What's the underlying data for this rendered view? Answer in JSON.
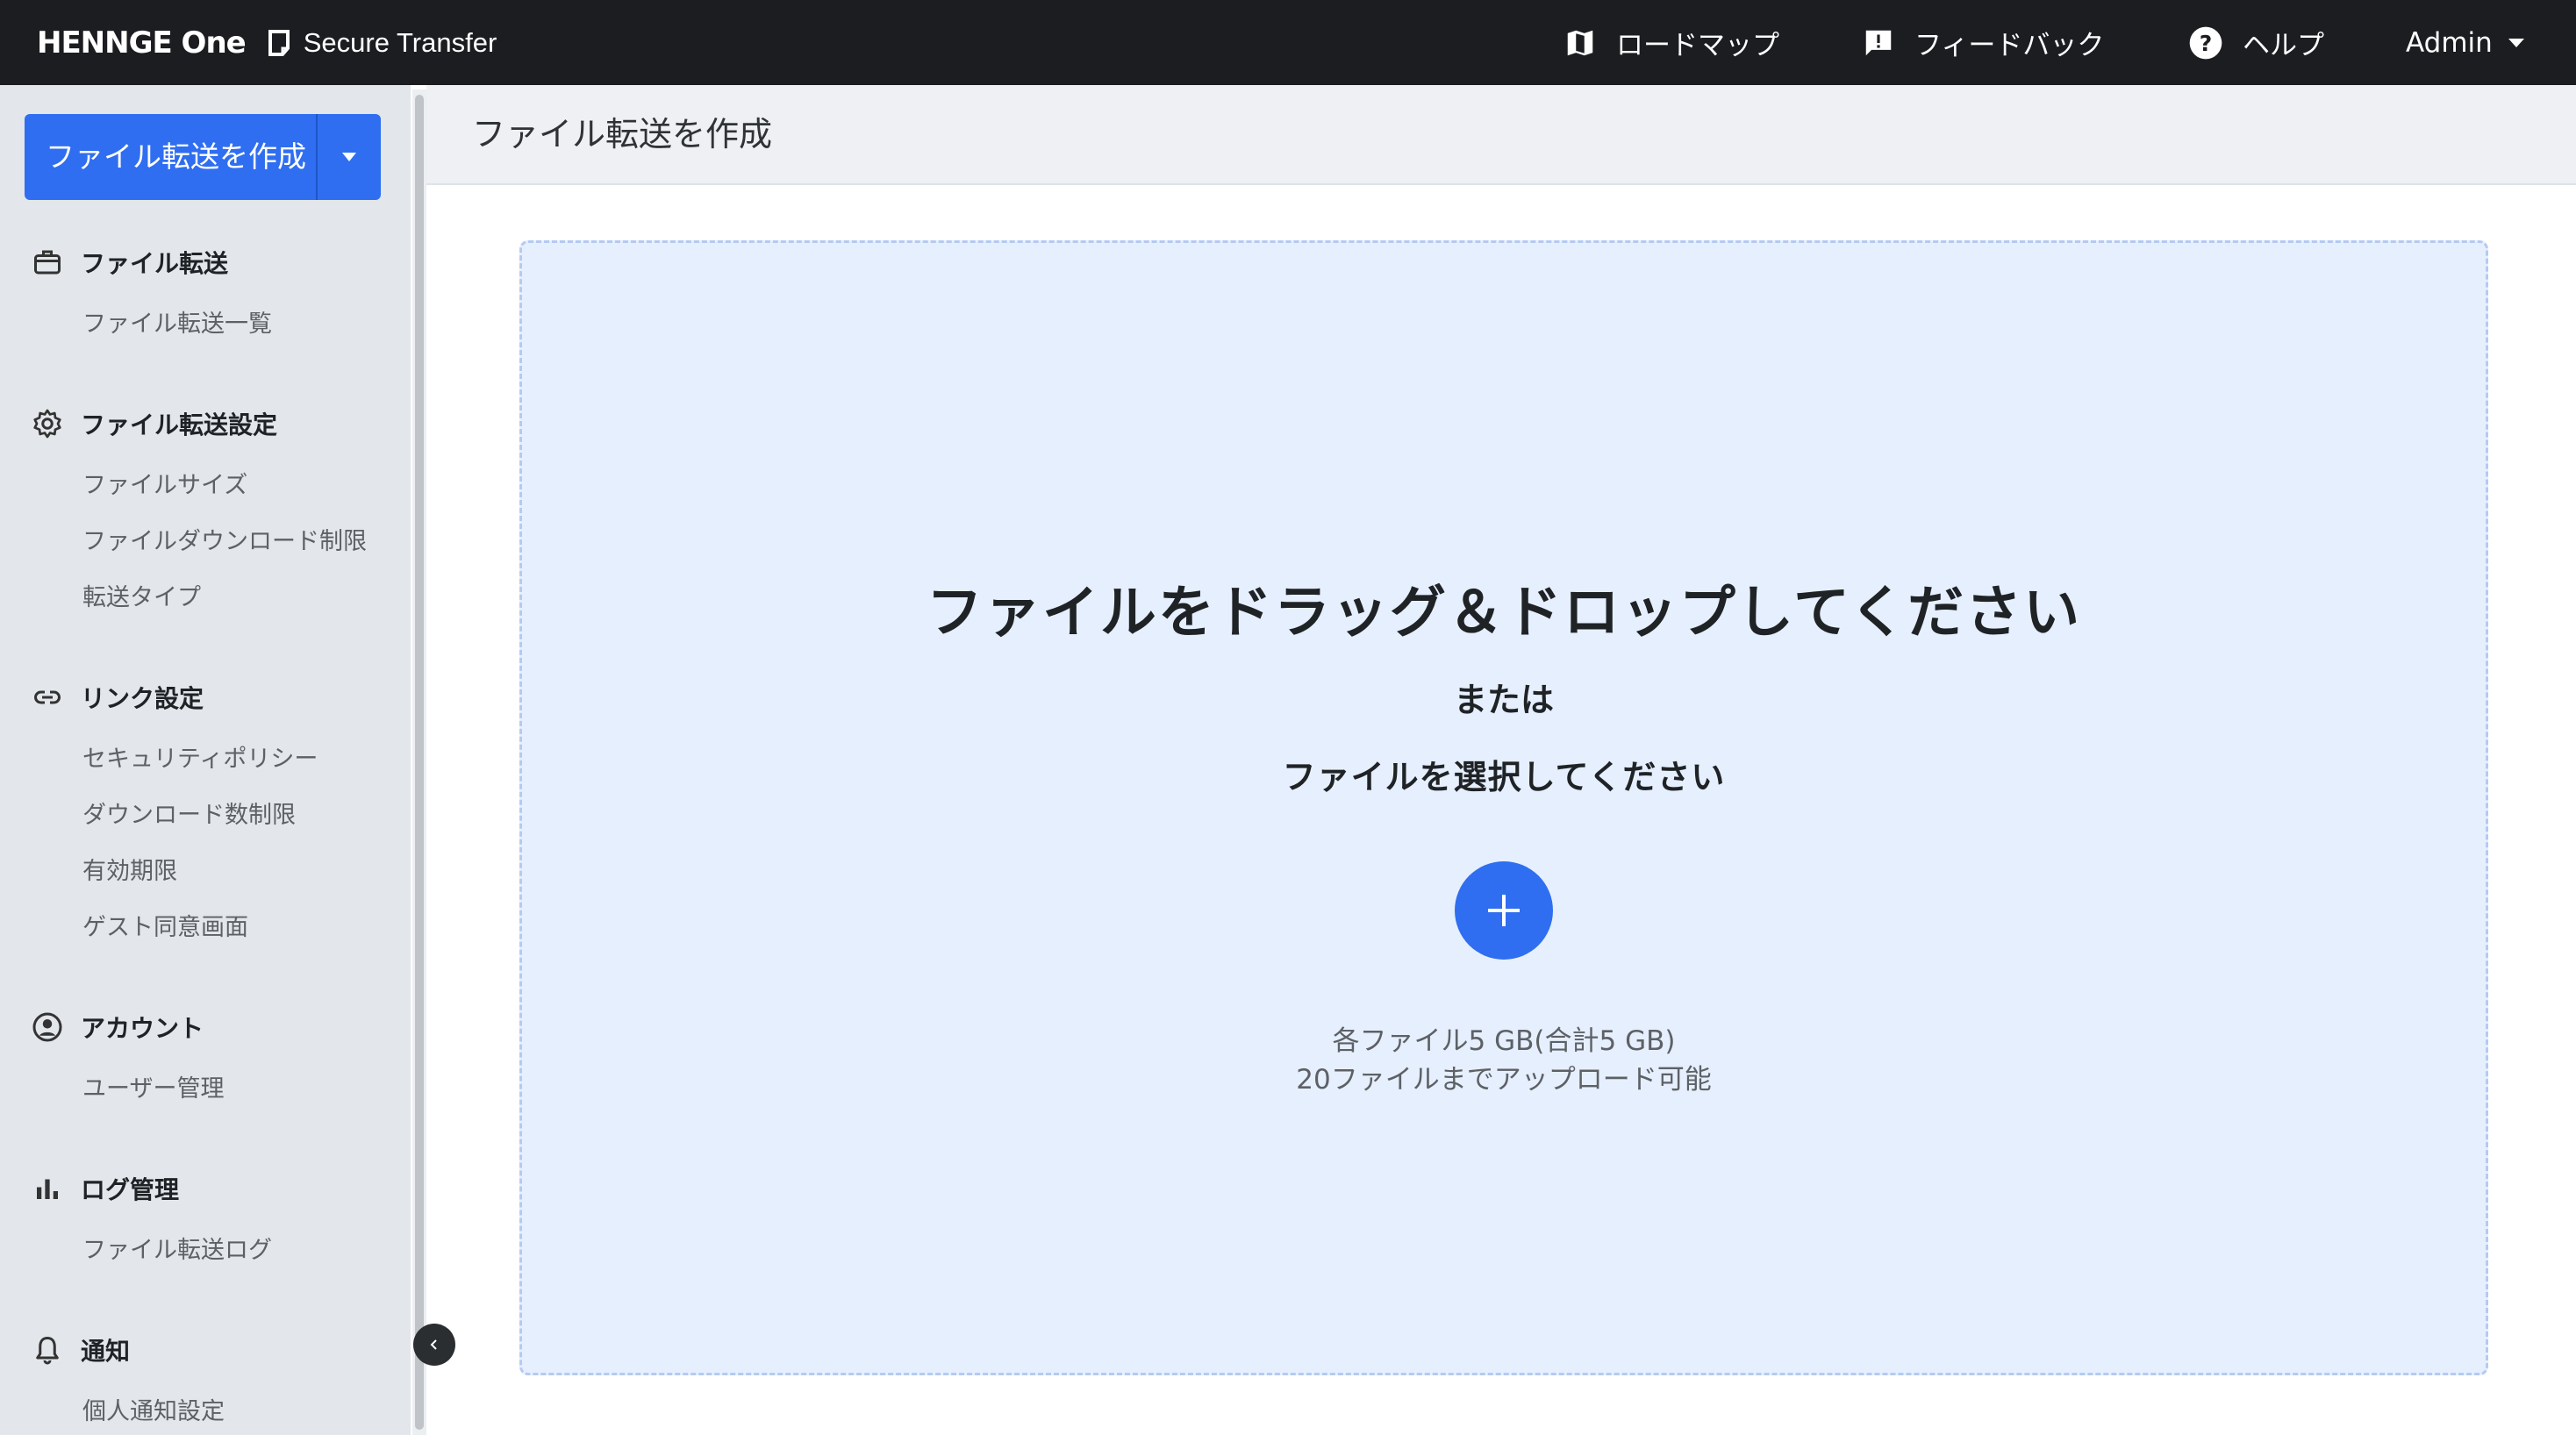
{
  "topbar": {
    "brand": "HENNGE One",
    "product": "Secure Transfer",
    "roadmap": "ロードマップ",
    "feedback": "フィードバック",
    "help": "ヘルプ",
    "user": "Admin"
  },
  "sidebar": {
    "create_button": "ファイル転送を作成",
    "sections": [
      {
        "icon": "briefcase-icon",
        "title": "ファイル転送",
        "items": [
          "ファイル転送一覧"
        ]
      },
      {
        "icon": "gear-icon",
        "title": "ファイル転送設定",
        "items": [
          "ファイルサイズ",
          "ファイルダウンロード制限",
          "転送タイプ"
        ]
      },
      {
        "icon": "link-icon",
        "title": "リンク設定",
        "items": [
          "セキュリティポリシー",
          "ダウンロード数制限",
          "有効期限",
          "ゲスト同意画面"
        ]
      },
      {
        "icon": "account-icon",
        "title": "アカウント",
        "items": [
          "ユーザー管理"
        ]
      },
      {
        "icon": "bar-chart-icon",
        "title": "ログ管理",
        "items": [
          "ファイル転送ログ"
        ]
      },
      {
        "icon": "bell-icon",
        "title": "通知",
        "items": [
          "個人通知設定"
        ]
      }
    ]
  },
  "main": {
    "title": "ファイル転送を作成",
    "dropzone": {
      "heading": "ファイルをドラッグ＆ドロップしてください",
      "or": "または",
      "select": "ファイルを選択してください",
      "limit_line1": "各ファイル5 GB(合計5 GB)",
      "limit_line2": "20ファイルまでアップロード可能"
    }
  },
  "colors": {
    "topbar": "#1b1d20",
    "accent": "#2f6ef0",
    "sidebar": "#e3e6ea",
    "dropzone_bg": "#e6effd"
  }
}
